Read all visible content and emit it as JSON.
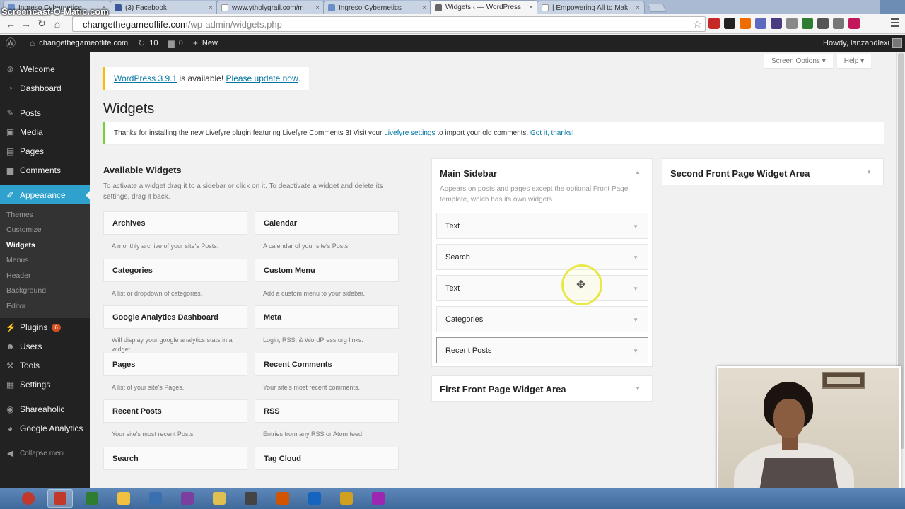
{
  "browser": {
    "tabs": [
      {
        "label": "Ingreso Cybernetics",
        "fav": "#6a8fc6",
        "active": false
      },
      {
        "label": "(3) Facebook",
        "fav": "#3b5998",
        "active": false
      },
      {
        "label": "www.ytholygrail.com/m",
        "fav": "#ffffff",
        "active": false
      },
      {
        "label": "Ingreso Cybernetics",
        "fav": "#6a8fc6",
        "active": false
      },
      {
        "label": "Widgets ‹ — WordPress",
        "fav": "#666666",
        "active": true
      },
      {
        "label": "| Empowering All to Mak",
        "fav": "#ffffff",
        "active": false
      }
    ],
    "close_glyph": "×",
    "url_host": "changethegameoflife.com",
    "url_path": "/wp-admin/widgets.php",
    "nav": {
      "back": "←",
      "forward": "→",
      "reload": "↻",
      "home": "⌂"
    }
  },
  "adminbar": {
    "site": "changethegameoflife.com",
    "updates": "10",
    "comments": "0",
    "new": "New",
    "howdy": "Howdy, lanzandlexi"
  },
  "sidebar": {
    "items": [
      {
        "label": "Welcome",
        "icon": "⊛"
      },
      {
        "label": "Dashboard",
        "icon": "◔"
      },
      {
        "label": "Posts",
        "icon": "✎"
      },
      {
        "label": "Media",
        "icon": "▣"
      },
      {
        "label": "Pages",
        "icon": "▤"
      },
      {
        "label": "Comments",
        "icon": "▆"
      },
      {
        "label": "Appearance",
        "icon": "✐"
      }
    ],
    "submenu": [
      "Themes",
      "Customize",
      "Widgets",
      "Menus",
      "Header",
      "Background",
      "Editor"
    ],
    "items2": [
      {
        "label": "Plugins",
        "icon": "⚡",
        "badge": "6"
      },
      {
        "label": "Users",
        "icon": "☻"
      },
      {
        "label": "Tools",
        "icon": "⚒"
      },
      {
        "label": "Settings",
        "icon": "▦"
      },
      {
        "label": "Shareaholic",
        "icon": "◉"
      },
      {
        "label": "Google Analytics",
        "icon": "◕"
      },
      {
        "label": "Collapse menu",
        "icon": "◀"
      }
    ]
  },
  "screen": {
    "options": "Screen Options ▾",
    "help": "Help ▾"
  },
  "update_notice": {
    "link1": "WordPress 3.9.1",
    "middle": " is available! ",
    "link2": "Please update now",
    "end": "."
  },
  "page_title": "Widgets",
  "livefyre_notice": {
    "text": "Thanks for installing the new Livefyre plugin featuring Livefyre Comments 3! Visit your ",
    "link": "Livefyre settings",
    "text2": " to import your old comments. ",
    "link2": "Got it, thanks!"
  },
  "available": {
    "title": "Available Widgets",
    "desc": "To activate a widget drag it to a sidebar or click on it. To deactivate a widget and delete its settings, drag it back.",
    "widgets": [
      {
        "name": "Archives",
        "desc": "A monthly archive of your site's Posts."
      },
      {
        "name": "Calendar",
        "desc": "A calendar of your site's Posts."
      },
      {
        "name": "Categories",
        "desc": "A list or dropdown of categories."
      },
      {
        "name": "Custom Menu",
        "desc": "Add a custom menu to your sidebar."
      },
      {
        "name": "Google Analytics Dashboard",
        "desc": "Will display your google analytics stats in a widget"
      },
      {
        "name": "Meta",
        "desc": "Login, RSS, & WordPress.org links."
      },
      {
        "name": "Pages",
        "desc": "A list of your site's Pages."
      },
      {
        "name": "Recent Comments",
        "desc": "Your site's most recent comments."
      },
      {
        "name": "Recent Posts",
        "desc": "Your site's most recent Posts."
      },
      {
        "name": "RSS",
        "desc": "Entries from any RSS or Atom feed."
      },
      {
        "name": "Search",
        "desc": ""
      },
      {
        "name": "Tag Cloud",
        "desc": ""
      }
    ]
  },
  "main_sidebar": {
    "title": "Main Sidebar",
    "desc": "Appears on posts and pages except the optional Front Page template, which has its own widgets",
    "widgets": [
      "Text",
      "Search",
      "Text",
      "Categories",
      "Recent Posts"
    ]
  },
  "front_area_1": {
    "title": "First Front Page Widget Area"
  },
  "front_area_2": {
    "title": "Second Front Page Widget Area"
  },
  "arrow_glyph": "▼",
  "arrow_up_glyph": "▲",
  "taskbar": {
    "watermark": "Screencast-O-Matic.com",
    "apps": [
      "#c0392b",
      "#2e7d32",
      "#f0c040",
      "#3a6fb0",
      "#7b3fa0",
      "#e0c050",
      "#444444",
      "#d35400",
      "#1565c0",
      "#d0a020",
      "#9c27b0"
    ]
  }
}
